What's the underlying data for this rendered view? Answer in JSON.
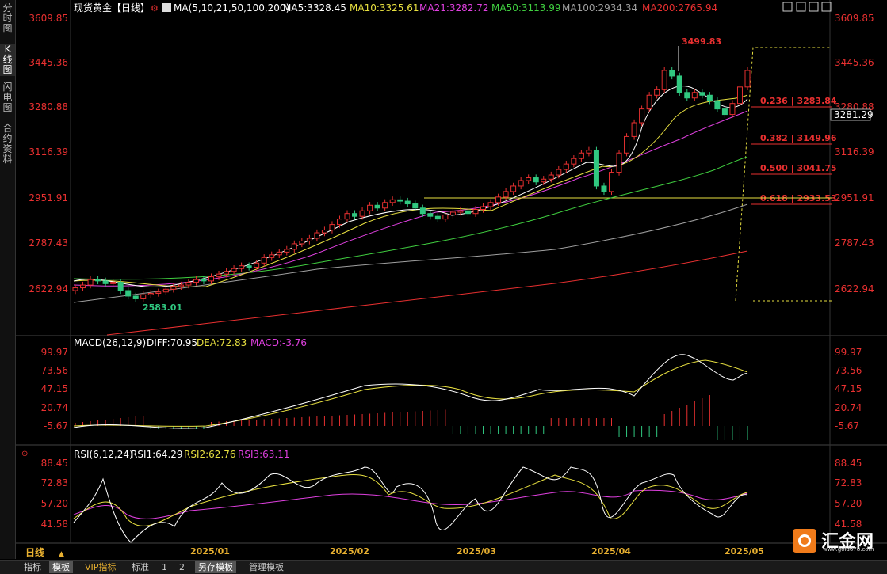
{
  "sidebar": {
    "tabs": [
      "分时图",
      "K线图",
      "闪电图",
      "合约资料"
    ]
  },
  "header": {
    "title": "现货黄金【日线】",
    "ma_label": "MA(5,10,21,50,100,200)",
    "ma_values": [
      {
        "text": "MA5:3328.45",
        "color": "#ffffff"
      },
      {
        "text": "MA10:3325.61",
        "color": "#e8e040"
      },
      {
        "text": "MA21:3282.72",
        "color": "#e040e0"
      },
      {
        "text": "MA50:3113.99",
        "color": "#40d040"
      },
      {
        "text": "MA100:2934.34",
        "color": "#a0a0a0"
      },
      {
        "text": "MA200:2765.94",
        "color": "#e83030"
      }
    ]
  },
  "price_axis": {
    "ticks": [
      "3609.85",
      "3445.36",
      "3280.88",
      "3116.39",
      "2951.91",
      "2787.43",
      "2622.94"
    ],
    "right_ticks": [
      "3609.85",
      "3445.36",
      "3280.88",
      "3116.39",
      "2951.91",
      "2787.43",
      "2622.94"
    ],
    "current_price": "3281.29",
    "high_label": "3499.83",
    "low_label": "2583.01"
  },
  "fibonacci": [
    {
      "label": "0.236 | 3283.84",
      "price": 3283.84
    },
    {
      "label": "0.382 | 3149.96",
      "price": 3149.96
    },
    {
      "label": "0.500 | 3041.75",
      "price": 3041.75
    },
    {
      "label": "0.618 | 2933.53",
      "price": 2933.53
    }
  ],
  "macd": {
    "title": "MACD(26,12,9)",
    "diff": "DIFF:70.95",
    "dea": "DEA:72.83",
    "macd": "MACD:-3.76",
    "ticks": [
      "99.97",
      "73.56",
      "47.15",
      "20.74",
      "-5.67"
    ]
  },
  "rsi": {
    "title": "RSI(6,12,24)",
    "rsi1": "RSI1:64.29",
    "rsi2": "RSI2:62.76",
    "rsi3": "RSI3:63.11",
    "ticks": [
      "88.45",
      "72.83",
      "57.20",
      "41.58"
    ]
  },
  "time_axis": {
    "period_label": "日线",
    "labels": [
      "2025/01",
      "2025/02",
      "2025/03",
      "2025/04",
      "2025/05"
    ]
  },
  "bottom_tabs": [
    "指标",
    "模板",
    "VIP指标",
    "标准",
    "1",
    "2",
    "另存模板",
    "管理模板"
  ],
  "logo": {
    "text": "汇金网",
    "sub": "www.gold678.com"
  },
  "colors": {
    "up": "#e83030",
    "down": "#30c880",
    "ma5": "#ffffff",
    "ma10": "#e8e040",
    "ma21": "#e040e0",
    "ma50": "#40d040",
    "ma100": "#a0a0a0",
    "ma200": "#e83030"
  },
  "chart_data": {
    "type": "candlestick",
    "period": "daily",
    "x_range": [
      "2024-12",
      "2025-05"
    ],
    "y_range": [
      2580,
      3620
    ],
    "high": 3499.83,
    "low": 2583.01,
    "moving_averages": {
      "MA5": 3328.45,
      "MA10": 3325.61,
      "MA21": 3282.72,
      "MA50": 3113.99,
      "MA100": 2934.34,
      "MA200": 2765.94
    },
    "close_track": [
      2630,
      2640,
      2660,
      2655,
      2645,
      2650,
      2620,
      2600,
      2590,
      2605,
      2610,
      2615,
      2625,
      2635,
      2640,
      2650,
      2660,
      2655,
      2670,
      2680,
      2690,
      2700,
      2710,
      2705,
      2720,
      2740,
      2750,
      2760,
      2770,
      2790,
      2800,
      2810,
      2830,
      2840,
      2860,
      2880,
      2900,
      2890,
      2910,
      2930,
      2920,
      2940,
      2950,
      2945,
      2935,
      2920,
      2900,
      2890,
      2880,
      2895,
      2905,
      2910,
      2900,
      2915,
      2925,
      2940,
      2960,
      2980,
      3000,
      3020,
      3030,
      3015,
      3025,
      3040,
      3060,
      3080,
      3100,
      3120,
      3130,
      3000,
      2980,
      3050,
      3120,
      3180,
      3230,
      3280,
      3330,
      3350,
      3420,
      3400,
      3340,
      3320,
      3340,
      3330,
      3310,
      3280,
      3260,
      3300,
      3360,
      3420
    ]
  }
}
